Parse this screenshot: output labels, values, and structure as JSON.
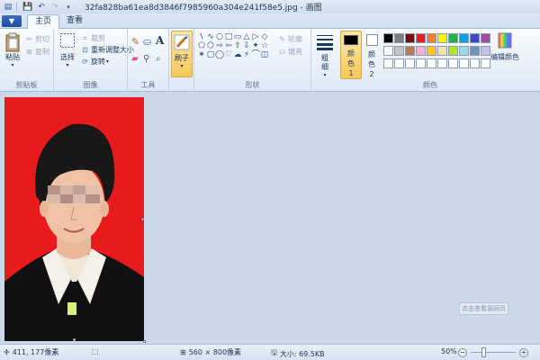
{
  "titlebar": {
    "title": "32fa828ba61ea8d3846f7985960a304e241f58e5.jpg - 画图"
  },
  "tabs": {
    "file": "▼",
    "home": "主页",
    "view": "查看"
  },
  "clipboard": {
    "paste": "粘贴",
    "cut": "剪切",
    "copy": "复制",
    "label": "剪贴板"
  },
  "image": {
    "select": "选择",
    "crop": "裁剪",
    "resize": "重新调整大小",
    "rotate": "旋转",
    "label": "图像"
  },
  "tools": {
    "label": "工具"
  },
  "brushes": {
    "label": "刷子"
  },
  "shapes": {
    "outline": "轮廓",
    "fill": "填充",
    "label": "形状",
    "glyphs": [
      "\\",
      "∿",
      "○",
      "□",
      "▭",
      "△",
      "▷",
      "◇",
      "⬠",
      "⬡",
      "⇨",
      "⇦",
      "⇧",
      "⇩",
      "✦",
      "☆",
      "✶",
      "▢",
      "◯",
      "♡",
      "☁",
      "⚡",
      "⌒",
      "◫"
    ]
  },
  "size": {
    "label": "粗细"
  },
  "colors": {
    "color1": "颜色 1",
    "color2": "颜色 2",
    "edit": "编辑颜色",
    "label": "颜色",
    "color1_value": "#000000",
    "color2_value": "#ffffff",
    "row1": [
      "#000000",
      "#7f7f7f",
      "#880015",
      "#ed1c24",
      "#ff7f27",
      "#fff200",
      "#22b14c",
      "#00a2e8",
      "#3f48cc",
      "#a349a4"
    ],
    "row2": [
      "#ffffff",
      "#c3c3c3",
      "#b97a57",
      "#ffaec9",
      "#ffc90e",
      "#efe4b0",
      "#b5e61d",
      "#99d9ea",
      "#7092be",
      "#c8bfe7"
    ],
    "row3": [
      "#ffffff",
      "#ffffff",
      "#ffffff",
      "#ffffff",
      "#ffffff",
      "#ffffff",
      "#ffffff",
      "#ffffff",
      "#ffffff",
      "#ffffff"
    ]
  },
  "canvas": {
    "watermark_hint": "点击查看源网页"
  },
  "status": {
    "cursor_pos": "411, 177像素",
    "dimensions": "560 × 800像素",
    "file_size": "大小: 69.5KB",
    "zoom": "50%",
    "zoom_out": "−",
    "zoom_in": "+"
  }
}
